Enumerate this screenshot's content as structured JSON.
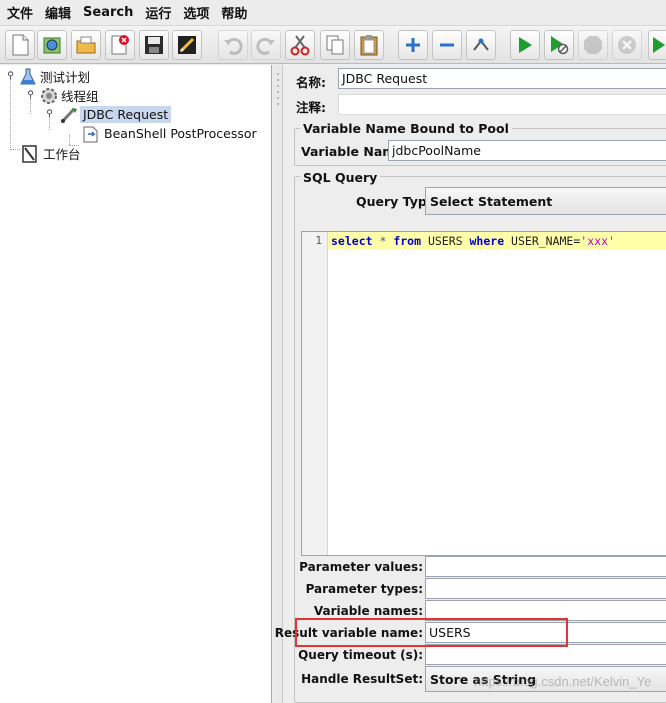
{
  "menu": [
    "文件",
    "编辑",
    "Search",
    "运行",
    "选项",
    "帮助"
  ],
  "toolbar": {
    "buttons": [
      {
        "name": "new-icon",
        "color": "#ffffff"
      },
      {
        "name": "templates-icon",
        "color": "#3a8a3a"
      },
      {
        "name": "open-icon",
        "color": "#d08a20"
      },
      {
        "name": "close-icon",
        "color": "#cc2222"
      },
      {
        "name": "save-icon",
        "color": "#333333"
      },
      {
        "name": "save-screenshot-icon",
        "color": "#c89a20"
      },
      {
        "name": "undo-icon",
        "color": "#9a9a9a"
      },
      {
        "name": "redo-icon",
        "color": "#9a9a9a"
      },
      {
        "name": "cut-icon",
        "color": "#cc2222"
      },
      {
        "name": "copy-icon",
        "color": "#555555"
      },
      {
        "name": "paste-icon",
        "color": "#b07a30"
      },
      {
        "name": "expand-icon",
        "color": "#2a6fc9"
      },
      {
        "name": "collapse-icon",
        "color": "#2a6fc9"
      },
      {
        "name": "toggle-icon",
        "color": "#555555"
      },
      {
        "name": "start-icon",
        "color": "#1f9d2f"
      },
      {
        "name": "start-no-pause-icon",
        "color": "#1f9d2f"
      },
      {
        "name": "stop-icon",
        "color": "#9a9a9a"
      },
      {
        "name": "shutdown-icon",
        "color": "#9a9a9a"
      },
      {
        "name": "remote-start-icon",
        "color": "#1f9d2f"
      }
    ]
  },
  "tree": {
    "items": [
      {
        "label": "测试计划",
        "icon": "test-plan-icon"
      },
      {
        "label": "线程组",
        "icon": "thread-group-icon"
      },
      {
        "label": "JDBC Request",
        "icon": "sampler-icon",
        "selected": true
      },
      {
        "label": "BeanShell PostProcessor",
        "icon": "postprocessor-icon"
      },
      {
        "label": "工作台",
        "icon": "workbench-icon"
      }
    ]
  },
  "form": {
    "name_label": "名称:",
    "name_value": "JDBC Request",
    "comment_label": "注释:",
    "comment_value": "",
    "pool_group_title": "Variable Name Bound to Pool",
    "variable_name_label": "Variable Name:",
    "variable_name_value": "jdbcPoolName",
    "sql_group_title": "SQL Query",
    "query_type_label": "Query Type:",
    "query_type_value": "Select Statement",
    "editor": {
      "line_number": "1",
      "tokens": {
        "kw_select": "select",
        "star": " * ",
        "kw_from": "from",
        "table": " USERS ",
        "kw_where": "where",
        "cond": " USER_NAME=",
        "str": "'xxx'"
      }
    },
    "params": [
      {
        "label": "Parameter values:",
        "value": ""
      },
      {
        "label": "Parameter types:",
        "value": ""
      },
      {
        "label": "Variable names:",
        "value": ""
      },
      {
        "label": "Result variable name:",
        "value": "USERS"
      },
      {
        "label": "Query timeout (s):",
        "value": ""
      },
      {
        "label": "Handle ResultSet:",
        "value": "Store as String"
      }
    ]
  },
  "colors": {
    "highlight": "#e53333",
    "editor_line": "#ffffaa",
    "selected_tree": "#c7d7ee"
  },
  "watermark": "https://blog.csdn.net/Kelvin_Ye"
}
